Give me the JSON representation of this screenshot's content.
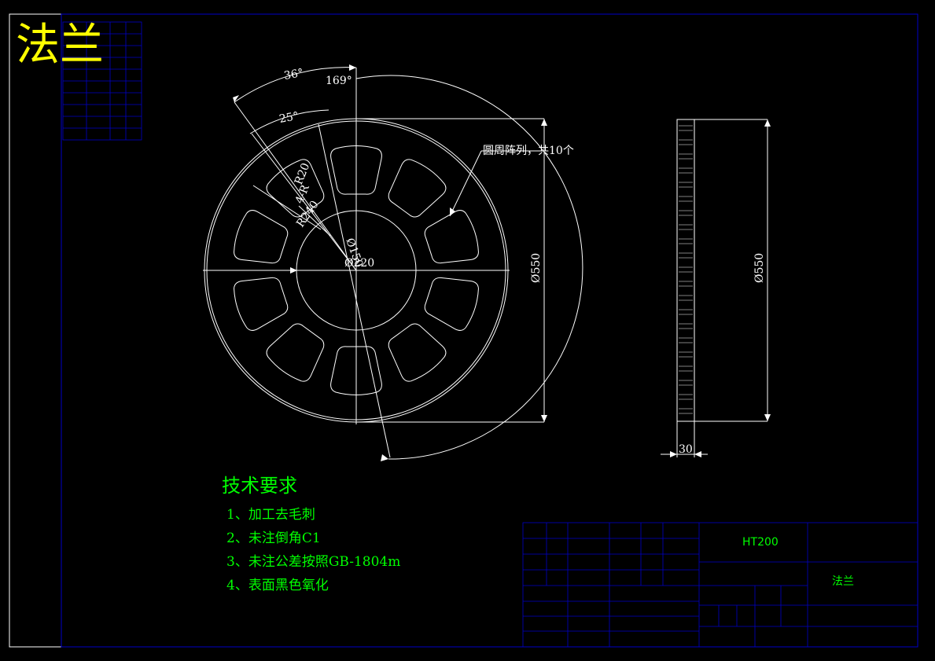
{
  "title": "法兰",
  "dimensions": {
    "angle_outer": "36°",
    "angle_inner": "25°",
    "angle_top": "169°",
    "radius_inner": "R20",
    "radius_pocket": "4-R",
    "radius_large": "R240",
    "diameter_small": "Ø150",
    "diameter_bore": "Ø220",
    "diameter_outer": "Ø550",
    "diameter_side": "Ø550",
    "thickness": "30",
    "array_note": "圆周阵列，共10个"
  },
  "tech_requirements": {
    "heading": "技术要求",
    "items": [
      "1、加工去毛刺",
      "2、未注倒角C1",
      "3、未注公差按照GB-1804m",
      "4、表面黑色氧化"
    ]
  },
  "title_block": {
    "material": "HT200",
    "part_name": "法兰"
  },
  "colors": {
    "background": "#000000",
    "lines": "#ffffff",
    "title_yellow": "#ffff00",
    "text_green": "#00ff00",
    "frame_blue": "#0000c8"
  }
}
